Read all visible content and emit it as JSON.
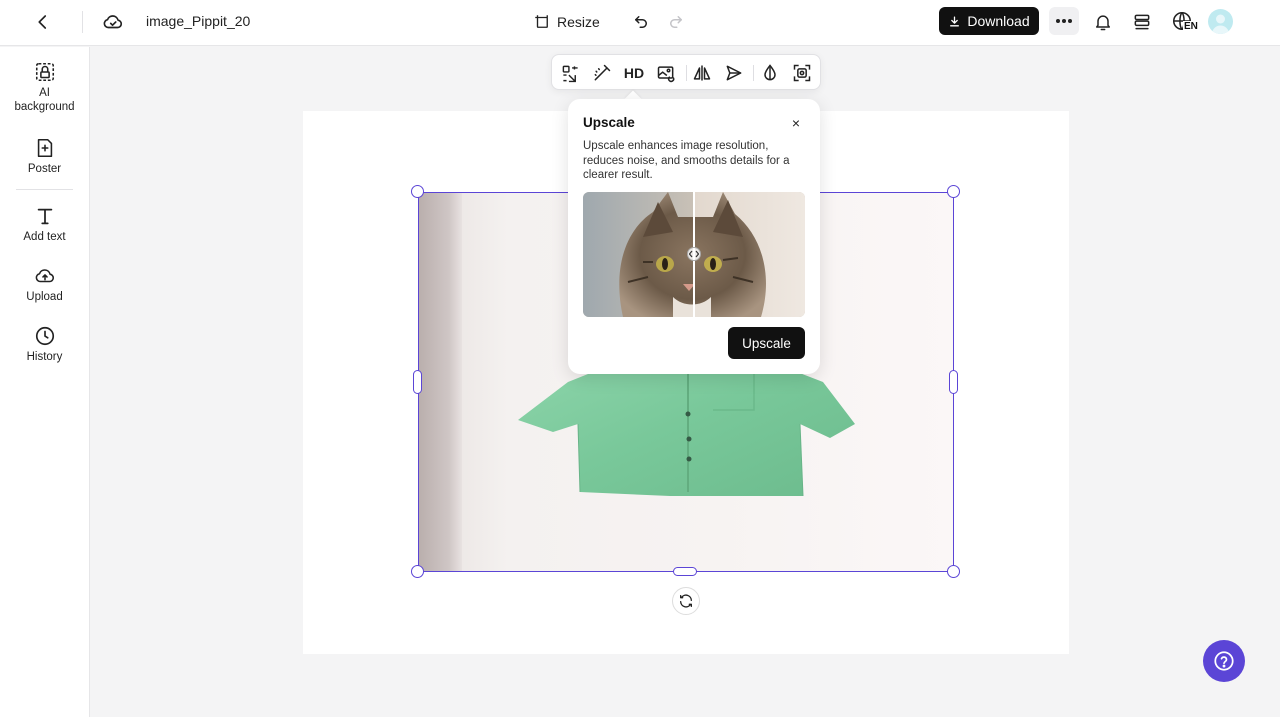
{
  "header": {
    "filename": "image_Pippit_20",
    "resize_label": "Resize",
    "download_label": "Download",
    "language_badge": "EN"
  },
  "sidebar": {
    "items": [
      {
        "label": "AI background",
        "icon": "ai-background-icon"
      },
      {
        "label": "Poster",
        "icon": "poster-icon"
      },
      {
        "label": "Add text",
        "icon": "text-icon"
      },
      {
        "label": "Upload",
        "icon": "upload-cloud-icon"
      },
      {
        "label": "History",
        "icon": "clock-icon"
      }
    ]
  },
  "toolbar": {
    "hd_label": "HD",
    "tools": [
      "smart-crop-icon",
      "magic-eraser-icon",
      "hd-icon",
      "image-replace-icon",
      "flip-icon",
      "send-icon",
      "opacity-icon",
      "focus-select-icon"
    ]
  },
  "popover": {
    "title": "Upscale",
    "description": "Upscale enhances image resolution, reduces noise, and smooths details for a clearer result.",
    "button_label": "Upscale",
    "close_glyph": "×"
  },
  "colors": {
    "accent": "#5b45d6",
    "primary_button": "#111111"
  }
}
